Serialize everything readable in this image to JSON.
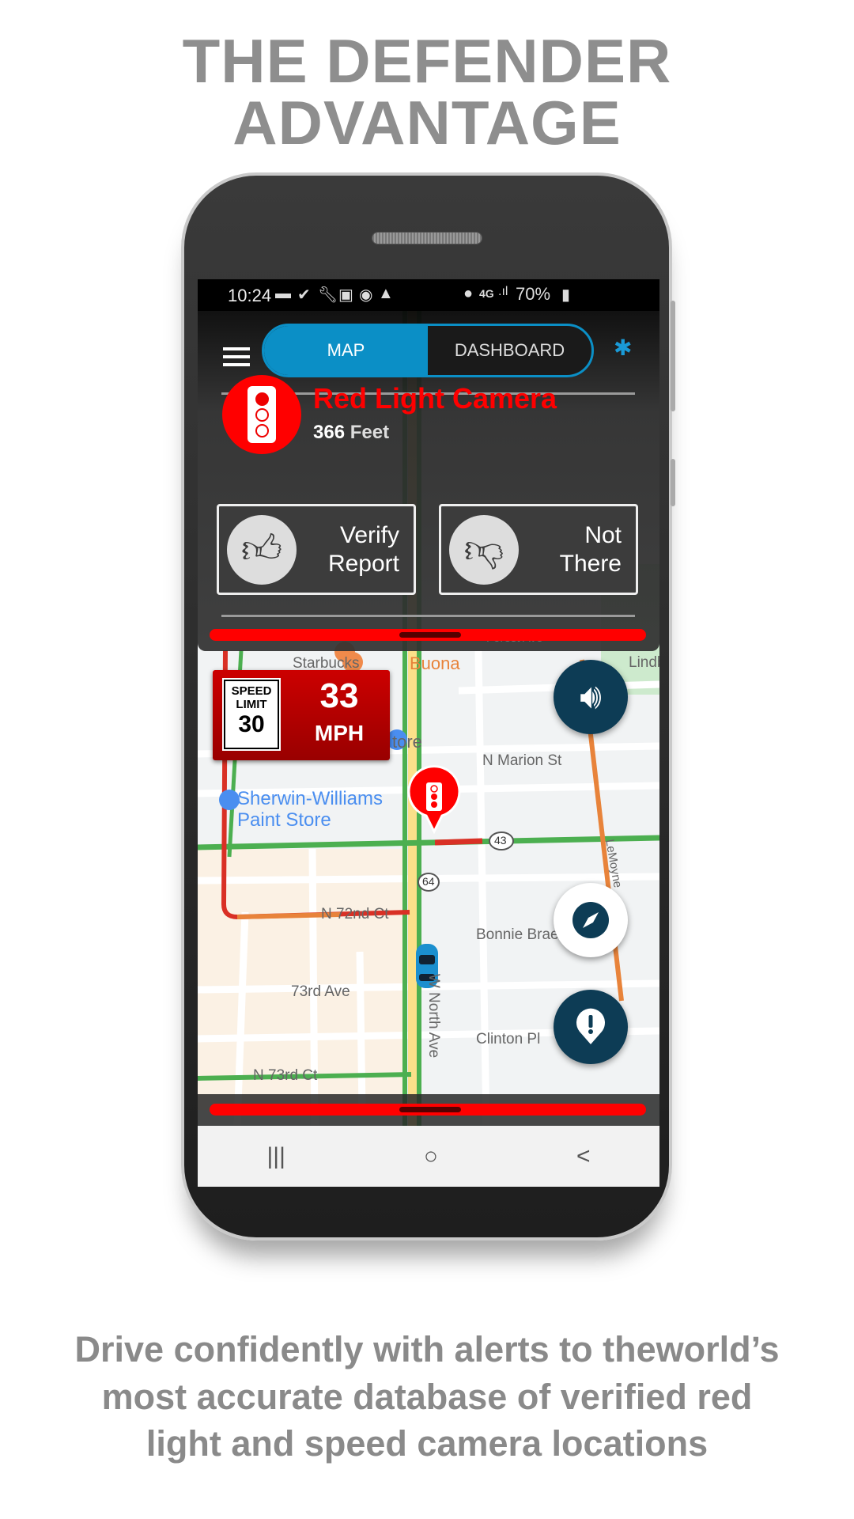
{
  "headline": {
    "line1": "THE DEFENDER",
    "line2": "ADVANTAGE"
  },
  "status_bar": {
    "time": "10:24",
    "network": "4G",
    "battery": "70%"
  },
  "header": {
    "tabs": [
      {
        "label": "MAP",
        "active": true
      },
      {
        "label": "DASHBOARD",
        "active": false
      }
    ]
  },
  "alert": {
    "title": "Red Light Camera",
    "distance_value": "366",
    "distance_unit": "Feet",
    "verify_label_1": "Verify",
    "verify_label_2": "Report",
    "not_there_label_1": "Not",
    "not_there_label_2": "There"
  },
  "speed": {
    "limit_label_1": "SPEED",
    "limit_label_2": "LIMIT",
    "limit": "30",
    "current": "33",
    "unit": "MPH"
  },
  "map": {
    "labels": [
      "Buona",
      "N Marion St",
      "Sherwin-Williams",
      "Paint Store",
      "Bonnie Brae",
      "Clinton Pl",
      "73rd Ave",
      "N 72nd Ct",
      "N 73rd Ct",
      "W North Ave",
      "Lindbe",
      "Starbucks",
      "tore",
      "LeMoyne",
      "43",
      "64",
      "Forest Ave"
    ]
  },
  "nav": {
    "recents": "|||",
    "home": "○",
    "back": "<"
  },
  "tagline": {
    "line1": "Drive confidently with alerts to theworld’s",
    "line2": "most accurate database of verified red",
    "line3": "light and speed camera locations"
  },
  "colors": {
    "accent": "#0b8fc6",
    "alert_red": "#ff0000",
    "fab": "#0d3c55"
  }
}
